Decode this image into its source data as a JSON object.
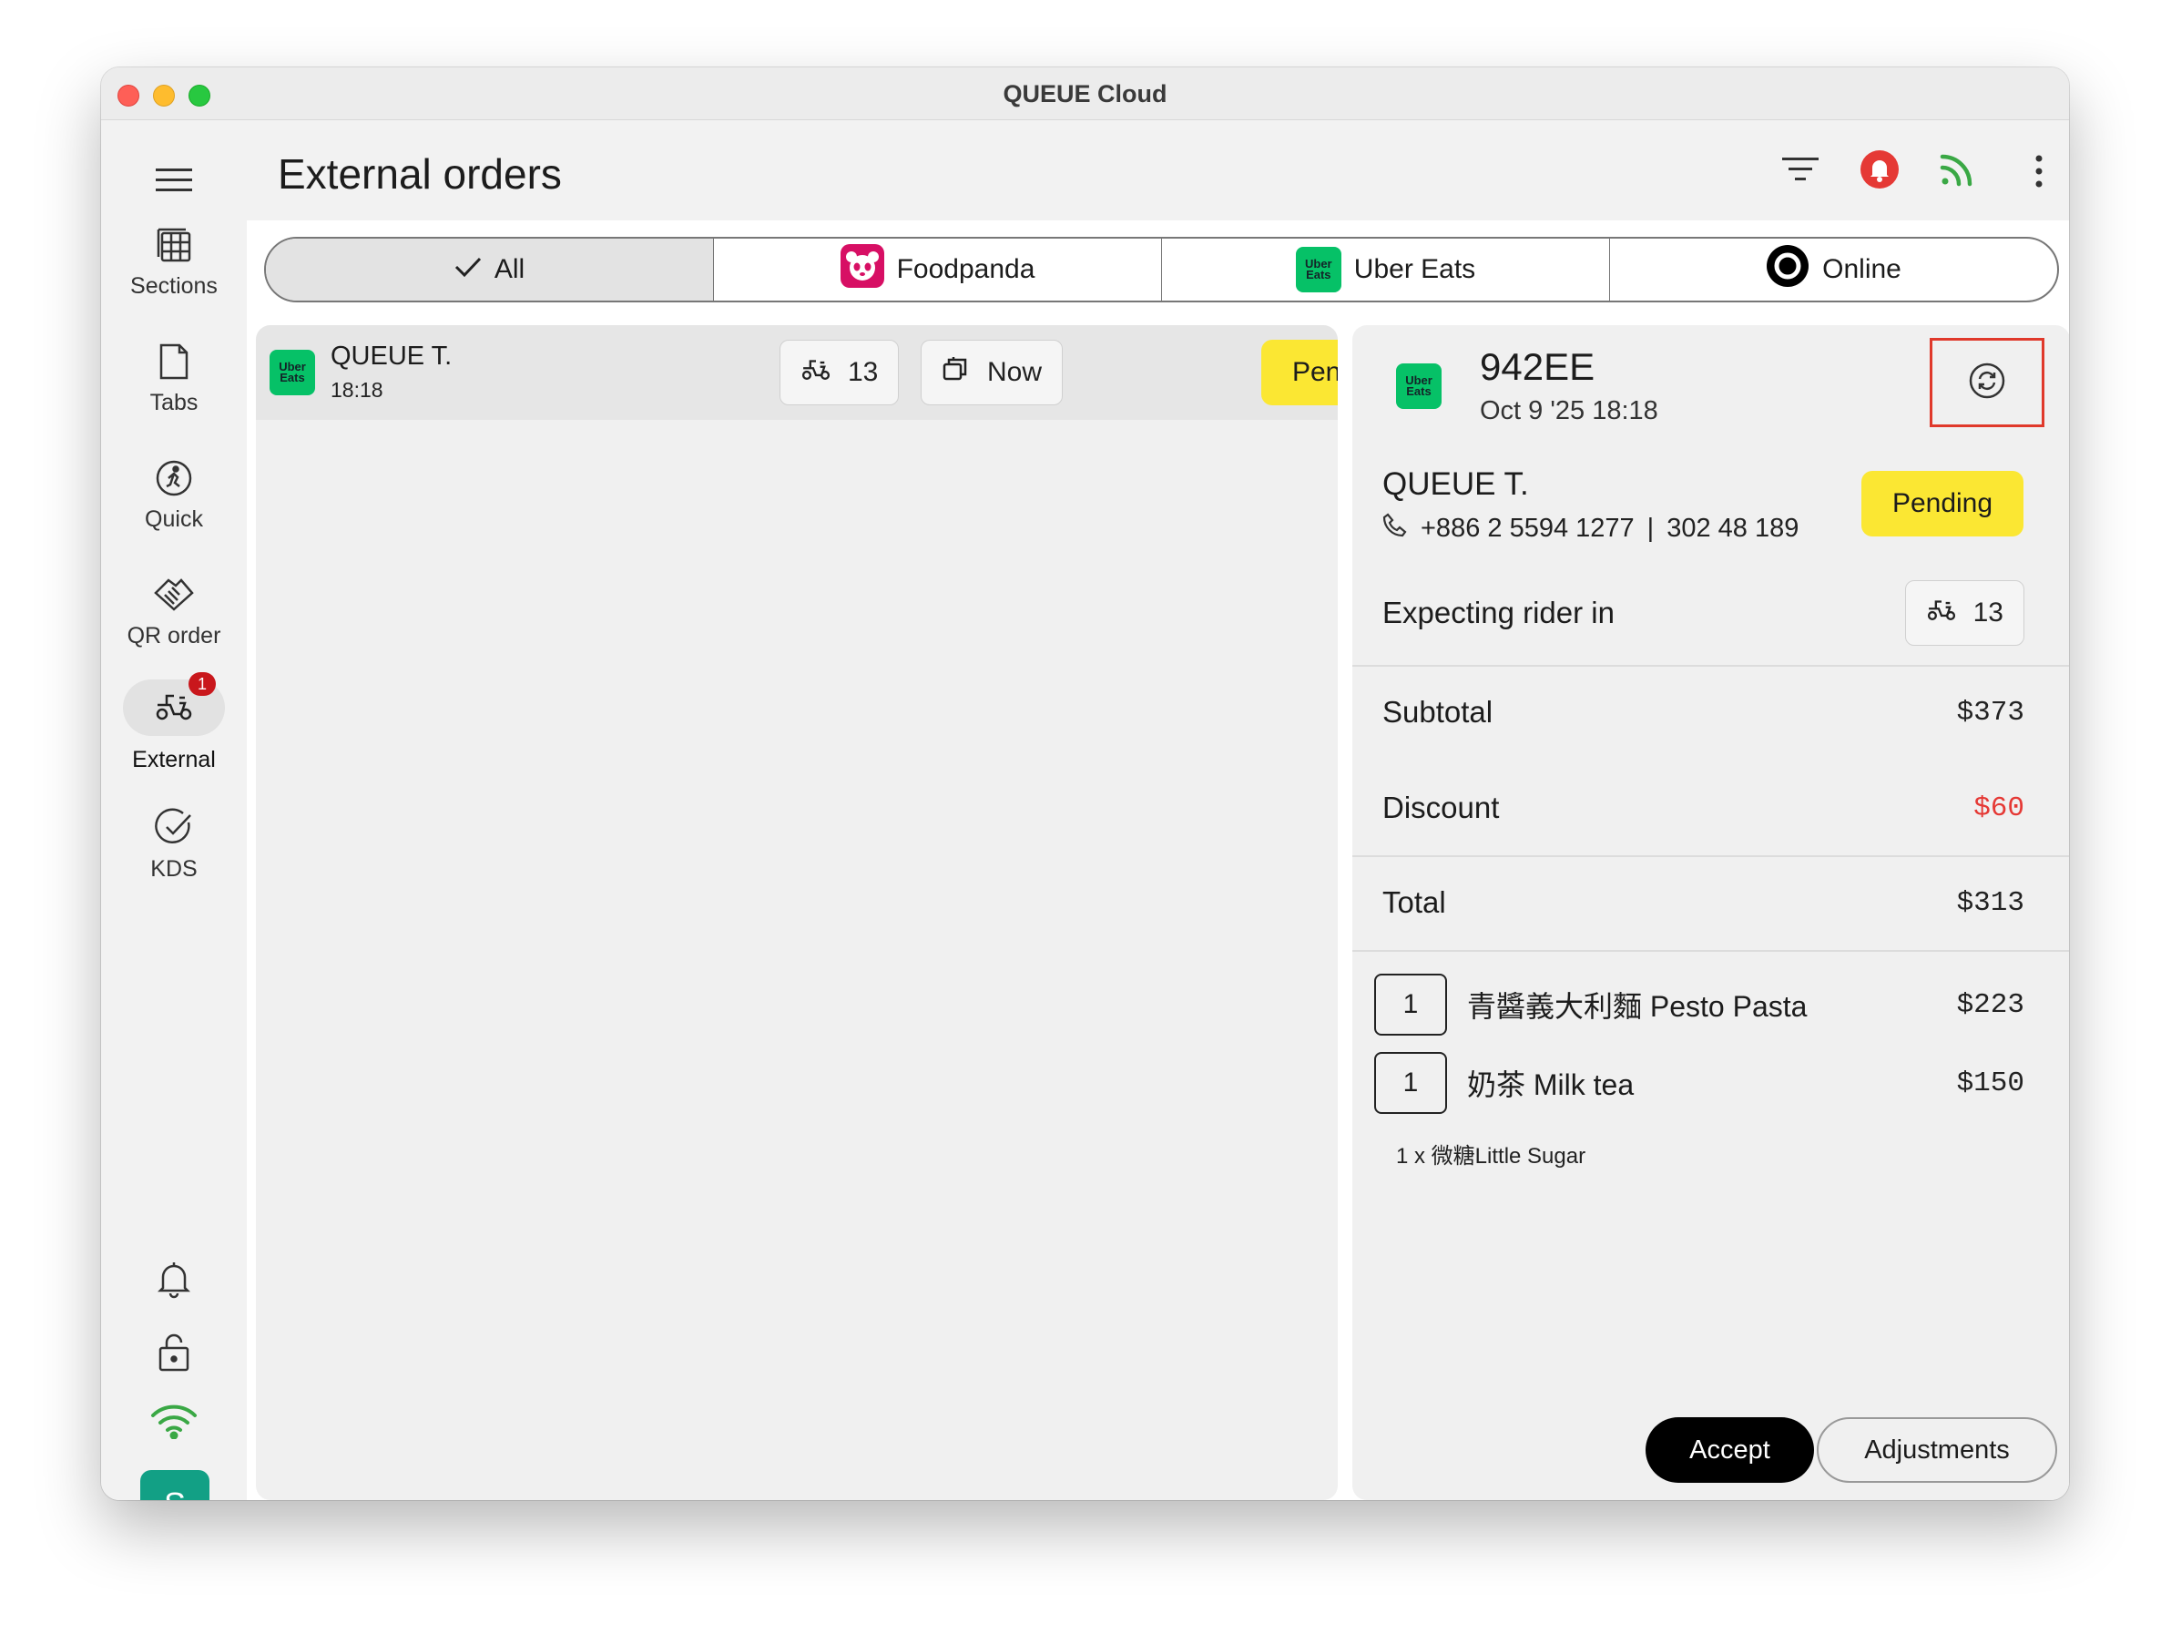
{
  "window": {
    "title": "QUEUE Cloud"
  },
  "sidebar": {
    "items": [
      {
        "label": "Sections",
        "icon": "sections-icon"
      },
      {
        "label": "Tabs",
        "icon": "tabs-icon"
      },
      {
        "label": "Quick",
        "icon": "quick-icon"
      },
      {
        "label": "QR order",
        "icon": "qr-order-icon"
      },
      {
        "label": "External",
        "icon": "external-delivery-icon",
        "badge": "1",
        "active": true
      },
      {
        "label": "KDS",
        "icon": "kds-icon"
      }
    ],
    "avatar": "S"
  },
  "header": {
    "title": "External orders"
  },
  "filters": {
    "tabs": [
      {
        "label": "All",
        "active": true
      },
      {
        "label": "Foodpanda"
      },
      {
        "label": "Uber Eats"
      },
      {
        "label": "Online"
      }
    ]
  },
  "order_list": [
    {
      "platform_logo_text": "Uber Eats",
      "customer": "QUEUE T.",
      "time": "18:18",
      "rider_eta": "13",
      "schedule": "Now",
      "status": "Pending"
    }
  ],
  "detail": {
    "platform_logo_text": "Uber Eats",
    "order_id": "942EE",
    "datetime": "Oct 9 '25 18:18",
    "customer": "QUEUE T.",
    "phone": "+886 2 5594 1277",
    "phone_separator": "|",
    "phone_ext": "302 48 189",
    "status": "Pending",
    "rider_label": "Expecting rider in",
    "rider_eta": "13",
    "subtotal_label": "Subtotal",
    "subtotal": "$373",
    "discount_label": "Discount",
    "discount": "$60",
    "total_label": "Total",
    "total": "$313",
    "items": [
      {
        "qty": "1",
        "name": "青醬義大利麵 Pesto Pasta",
        "price": "$223"
      },
      {
        "qty": "1",
        "name": "奶茶 Milk tea",
        "price": "$150"
      }
    ],
    "modifier": "1 x 微糖Little Sugar",
    "accept_label": "Accept",
    "adjust_label": "Adjustments"
  },
  "colors": {
    "pending": "#fbe733",
    "discount": "#e53935",
    "accept_bg": "#000000",
    "ubereats_green": "#06c167",
    "foodpanda_pink": "#d70f64",
    "notify_red": "#e53935",
    "online_green": "#3aa845",
    "badge_red": "#c9171c",
    "avatar_teal": "#12a085",
    "highlight_red": "#e0392b"
  }
}
